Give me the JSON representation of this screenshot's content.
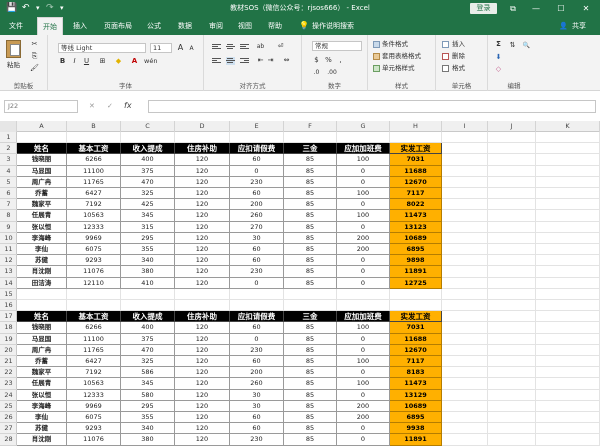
{
  "window": {
    "title": "教材SOS（微信公众号：rjsos666） - Excel",
    "login_button": "登录",
    "minimize_icon": "—",
    "maximize_icon": "☐",
    "close_icon": "✕",
    "restore_icon": "⧉",
    "save_icon": "💾",
    "undo_icon": "↶",
    "redo_icon": "↷",
    "customize_icon": "▾"
  },
  "menu": {
    "tabs": [
      "文件",
      "开始",
      "插入",
      "页面布局",
      "公式",
      "数据",
      "审阅",
      "视图",
      "帮助"
    ],
    "active_index": 1,
    "lightbulb_icon": "💡",
    "tell_me": "操作说明搜索",
    "share": "共享",
    "share_icon": "👤"
  },
  "ribbon": {
    "clipboard": {
      "label": "剪贴板",
      "paste": "粘贴",
      "cut_icon": "✂",
      "copy_icon": "⎘",
      "format_painter_icon": "🖌"
    },
    "font": {
      "label": "字体",
      "name": "等线 Light",
      "size": "11",
      "bold": "B",
      "italic": "I",
      "underline": "U",
      "grow": "A",
      "shrink": "A",
      "border_icon": "⊞",
      "fill_icon": "◆",
      "font_color_icon": "A",
      "wen": "wén"
    },
    "alignment": {
      "label": "对齐方式",
      "wrap_icon": "⏎",
      "merge_icon": "⇔",
      "orient_icon": "ab",
      "indent_icon": "⇤",
      "outdent_icon": "⇥"
    },
    "number": {
      "label": "数字",
      "format": "常规",
      "currency": "$",
      "percent": "%",
      "comma": ",",
      "inc_dec": ".0",
      "dec_dec": ".00"
    },
    "styles": {
      "label": "样式",
      "cond_format": "条件格式",
      "table_format": "套用表格格式",
      "cell_style": "单元格样式"
    },
    "cells": {
      "label": "单元格",
      "insert": "插入",
      "delete": "删除",
      "format": "格式"
    },
    "editing": {
      "label": "编辑",
      "sum_icon": "Σ",
      "sort_icon": "⇅",
      "find_icon": "🔍",
      "fill_icon": "⬇",
      "clear_icon": "◇"
    }
  },
  "formula_bar": {
    "name_box": "J22",
    "cancel_icon": "✕",
    "enter_icon": "✓",
    "fx": "fx",
    "content": ""
  },
  "grid": {
    "columns": [
      "A",
      "B",
      "C",
      "D",
      "E",
      "F",
      "G",
      "H",
      "I",
      "J",
      "K"
    ],
    "rows": [
      "1",
      "2",
      "3",
      "4",
      "5",
      "6",
      "7",
      "8",
      "9",
      "10",
      "11",
      "12",
      "13",
      "14",
      "15",
      "16",
      "17",
      "18",
      "19",
      "20",
      "21",
      "22",
      "23",
      "24",
      "25",
      "26",
      "27",
      "28"
    ],
    "headers": [
      "姓名",
      "基本工资",
      "收入提成",
      "住房补助",
      "应扣请假费",
      "三金",
      "应加加班费",
      "实发工资"
    ],
    "table1": [
      [
        "钱晓丽",
        "6266",
        "400",
        "120",
        "60",
        "85",
        "100",
        "7031"
      ],
      [
        "马显国",
        "11100",
        "375",
        "120",
        "0",
        "85",
        "0",
        "11688"
      ],
      [
        "周广冉",
        "11765",
        "470",
        "120",
        "230",
        "85",
        "0",
        "12670"
      ],
      [
        "乔蓄",
        "6427",
        "325",
        "120",
        "60",
        "85",
        "100",
        "7117"
      ],
      [
        "魏家平",
        "7192",
        "425",
        "120",
        "200",
        "85",
        "0",
        "8022"
      ],
      [
        "任展青",
        "10563",
        "345",
        "120",
        "260",
        "85",
        "100",
        "11473"
      ],
      [
        "张以恒",
        "12333",
        "315",
        "120",
        "270",
        "85",
        "0",
        "13123"
      ],
      [
        "李海峰",
        "9969",
        "295",
        "120",
        "30",
        "85",
        "200",
        "10689"
      ],
      [
        "李仙",
        "6075",
        "355",
        "120",
        "60",
        "85",
        "200",
        "6895"
      ],
      [
        "苏健",
        "9293",
        "340",
        "120",
        "60",
        "85",
        "0",
        "9898"
      ],
      [
        "肖沈刚",
        "11076",
        "380",
        "120",
        "230",
        "85",
        "0",
        "11891"
      ],
      [
        "田洁涛",
        "12110",
        "410",
        "120",
        "0",
        "85",
        "0",
        "12725"
      ]
    ],
    "table2": [
      [
        "钱晓丽",
        "6266",
        "400",
        "120",
        "60",
        "85",
        "100",
        "7031"
      ],
      [
        "马显国",
        "11100",
        "375",
        "120",
        "0",
        "85",
        "0",
        "11688"
      ],
      [
        "周广冉",
        "11765",
        "470",
        "120",
        "230",
        "85",
        "0",
        "12670"
      ],
      [
        "乔蓄",
        "6427",
        "325",
        "120",
        "60",
        "85",
        "100",
        "7117"
      ],
      [
        "魏家平",
        "7192",
        "586",
        "120",
        "200",
        "85",
        "0",
        "8183"
      ],
      [
        "任展青",
        "10563",
        "345",
        "120",
        "260",
        "85",
        "100",
        "11473"
      ],
      [
        "张以恒",
        "12333",
        "580",
        "120",
        "30",
        "85",
        "0",
        "13129"
      ],
      [
        "李海峰",
        "9969",
        "295",
        "120",
        "30",
        "85",
        "200",
        "10689"
      ],
      [
        "李仙",
        "6075",
        "355",
        "120",
        "60",
        "85",
        "200",
        "6895"
      ],
      [
        "苏健",
        "9293",
        "340",
        "120",
        "60",
        "85",
        "0",
        "9938"
      ],
      [
        "肖沈刚",
        "11076",
        "380",
        "120",
        "230",
        "85",
        "0",
        "11891"
      ]
    ]
  }
}
